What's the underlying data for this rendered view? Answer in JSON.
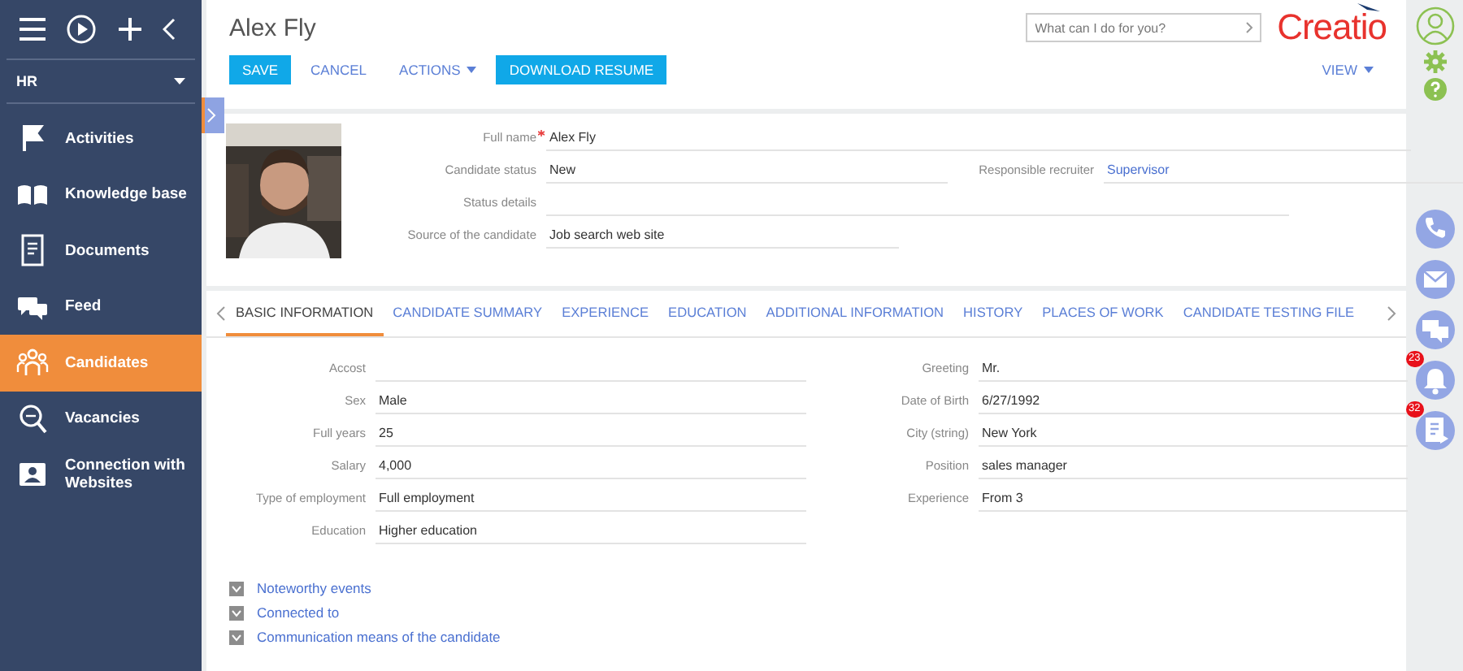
{
  "sidebar": {
    "section": {
      "label": "HR"
    },
    "items": [
      {
        "label": "Activities",
        "selected": false
      },
      {
        "label": "Knowledge base",
        "selected": false
      },
      {
        "label": "Documents",
        "selected": false
      },
      {
        "label": "Feed",
        "selected": false
      },
      {
        "label": "Candidates",
        "selected": true
      },
      {
        "label": "Vacancies",
        "selected": false
      },
      {
        "label": "Connection with Websites",
        "selected": false
      }
    ]
  },
  "header": {
    "title": "Alex Fly",
    "buttons": [
      {
        "label": "SAVE",
        "kind": "primary"
      },
      {
        "label": "CANCEL",
        "kind": "link"
      },
      {
        "label": "ACTIONS",
        "kind": "dropdown"
      },
      {
        "label": "DOWNLOAD RESUME",
        "kind": "primary"
      }
    ],
    "search": {
      "placeholder": "What can I do for you?"
    },
    "logo": "Creatio",
    "view_button": "VIEW"
  },
  "profile": {
    "rows": [
      [
        {
          "label": "Full name",
          "value": "Alex Fly",
          "required": true,
          "kind": "text"
        }
      ],
      [
        {
          "label": "Candidate status",
          "value": "New",
          "required": false,
          "kind": "text"
        },
        {
          "label": "Responsible recruiter",
          "value": "Supervisor",
          "required": false,
          "kind": "link"
        }
      ],
      [
        {
          "label": "Status details",
          "required": false,
          "kind": "text"
        }
      ],
      [
        {
          "label": "Source of the candidate",
          "value": "Job search web site",
          "required": false,
          "kind": "text"
        }
      ]
    ]
  },
  "tabs": [
    {
      "label": "BASIC INFORMATION",
      "selected": true
    },
    {
      "label": "CANDIDATE SUMMARY",
      "selected": false
    },
    {
      "label": "EXPERIENCE",
      "selected": false
    },
    {
      "label": "EDUCATION",
      "selected": false
    },
    {
      "label": "ADDITIONAL INFORMATION",
      "selected": false
    },
    {
      "label": "HISTORY",
      "selected": false
    },
    {
      "label": "PLACES OF WORK",
      "selected": false
    },
    {
      "label": "CANDIDATE TESTING FILE",
      "selected": false
    }
  ],
  "basic_info": {
    "left": [
      {
        "label": "Accost"
      },
      {
        "label": "Sex",
        "value": "Male"
      },
      {
        "label": "Full years",
        "value": "25"
      },
      {
        "label": "Salary",
        "value": "4,000"
      },
      {
        "label": "Type of employment",
        "value": "Full employment"
      },
      {
        "label": "Education",
        "value": "Higher education"
      }
    ],
    "right": [
      {
        "label": "Greeting",
        "value": "Mr."
      },
      {
        "label": "Date of Birth",
        "value": "6/27/1992"
      },
      {
        "label": "City (string)",
        "value": "New York"
      },
      {
        "label": "Position",
        "value": "sales manager"
      },
      {
        "label": "Experience",
        "value": "From 3"
      }
    ]
  },
  "groups": [
    {
      "label": "Noteworthy events",
      "expanded": false
    },
    {
      "label": "Connected to",
      "expanded": false
    },
    {
      "label": "Communication means of the candidate",
      "expanded": false
    }
  ],
  "right_rail": {
    "notification_count": "23",
    "task_count": "32"
  }
}
